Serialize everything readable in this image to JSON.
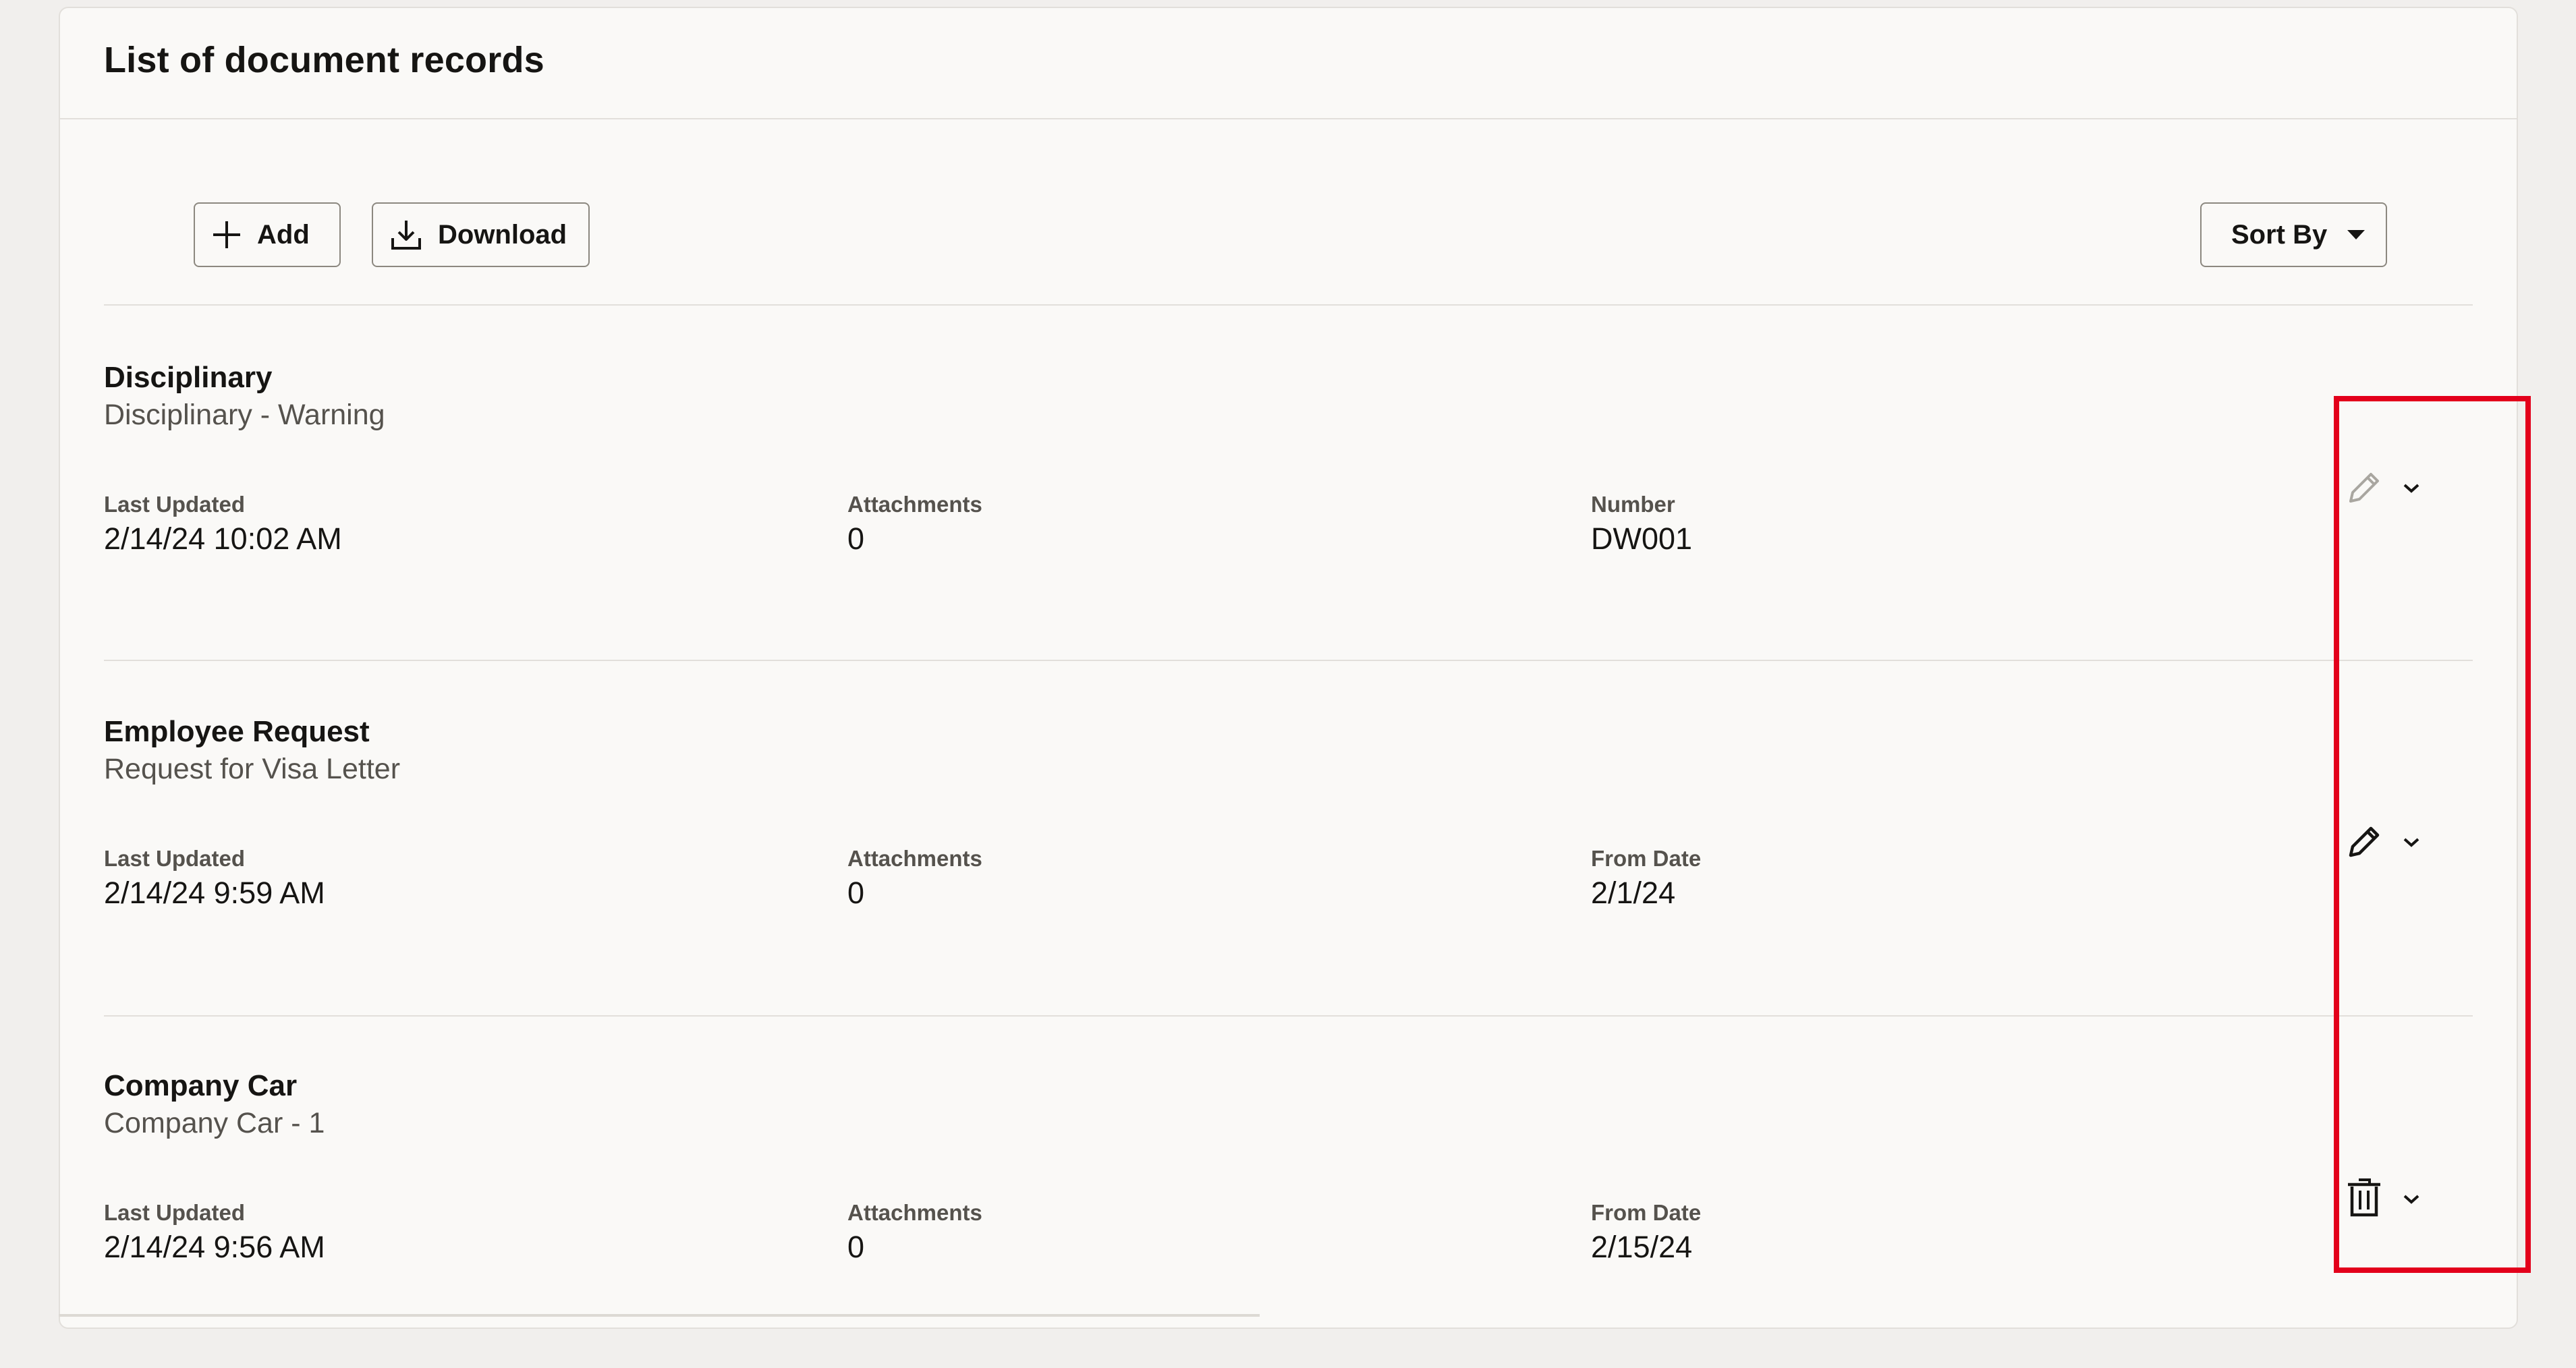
{
  "panel": {
    "title": "List of document records"
  },
  "toolbar": {
    "add_label": "Add",
    "download_label": "Download",
    "sort_label": "Sort By"
  },
  "records": [
    {
      "title": "Disciplinary",
      "subtitle": "Disciplinary - Warning",
      "fields": [
        {
          "label": "Last Updated",
          "value": "2/14/24 10:02 AM"
        },
        {
          "label": "Attachments",
          "value": "0"
        },
        {
          "label": "Number",
          "value": "DW001"
        }
      ],
      "action_icon": "pencil-icon",
      "action_state": "disabled"
    },
    {
      "title": "Employee Request",
      "subtitle": "Request for Visa Letter",
      "fields": [
        {
          "label": "Last Updated",
          "value": "2/14/24 9:59 AM"
        },
        {
          "label": "Attachments",
          "value": "0"
        },
        {
          "label": "From Date",
          "value": "2/1/24"
        }
      ],
      "action_icon": "pencil-icon",
      "action_state": "enabled"
    },
    {
      "title": "Company Car",
      "subtitle": "Company Car - 1",
      "fields": [
        {
          "label": "Last Updated",
          "value": "2/14/24 9:56 AM"
        },
        {
          "label": "Attachments",
          "value": "0"
        },
        {
          "label": "From Date",
          "value": "2/15/24"
        }
      ],
      "action_icon": "trash-icon",
      "action_state": "enabled"
    }
  ],
  "colors": {
    "highlight": "#e3001b",
    "text": "#161513",
    "muted": "#55524d",
    "disabled_icon": "#a9a6a0",
    "panel_bg": "#faf9f7"
  }
}
